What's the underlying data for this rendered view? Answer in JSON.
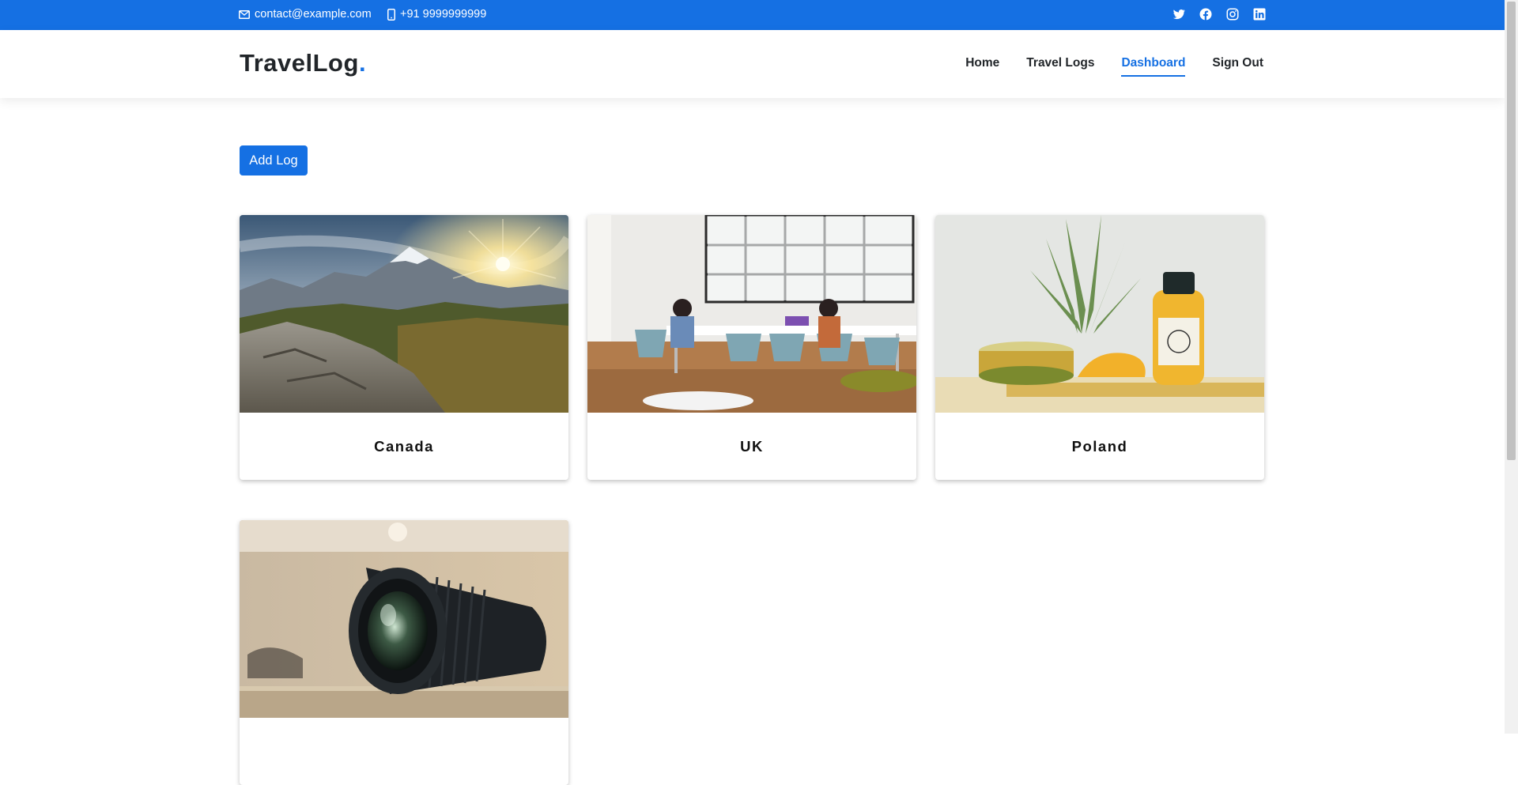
{
  "topbar": {
    "email": "contact@example.com",
    "phone": "+91 9999999999",
    "socials": [
      "twitter-icon",
      "facebook-icon",
      "instagram-icon",
      "linkedin-icon"
    ]
  },
  "header": {
    "logo_text": "TravelLog",
    "logo_dot": ".",
    "nav": [
      {
        "label": "Home",
        "active": false
      },
      {
        "label": "Travel Logs",
        "active": false
      },
      {
        "label": "Dashboard",
        "active": true
      },
      {
        "label": "Sign Out",
        "active": false
      }
    ]
  },
  "actions": {
    "add_log_label": "Add Log"
  },
  "cards": [
    {
      "title": "Canada",
      "image": "mountain-sunset-photo"
    },
    {
      "title": "UK",
      "image": "office-meeting-photo"
    },
    {
      "title": "Poland",
      "image": "pineapple-juice-photo"
    },
    {
      "title": "",
      "image": "camera-lens-photo"
    }
  ],
  "colors": {
    "brand": "#1570e3",
    "text": "#212529"
  }
}
